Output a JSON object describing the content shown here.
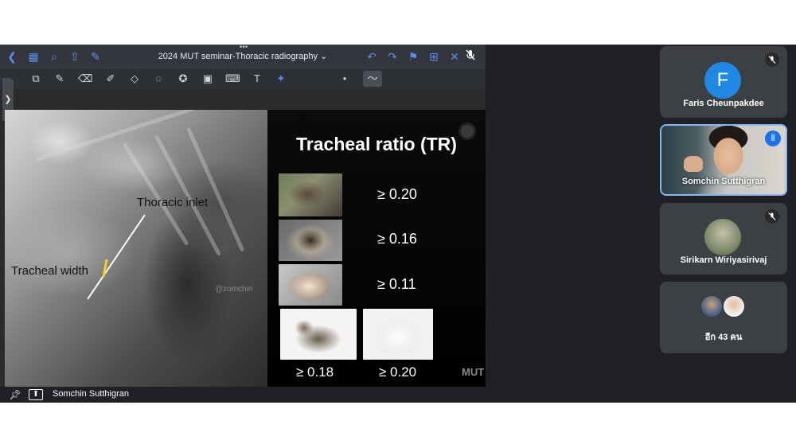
{
  "presentation": {
    "doc_title": "2024 MUT seminar-Thoracic radiography",
    "title_chevron": "⌄",
    "grip": "•••",
    "top_icons": {
      "back": "chevron-left-icon",
      "grid": "grid-icon",
      "search": "search-icon",
      "share": "share-icon",
      "mic_marker": "pen-mic-icon",
      "undo": "undo-icon",
      "redo": "redo-icon",
      "bookmark": "bookmark-icon",
      "add_page": "add-page-icon",
      "close": "close-icon",
      "muted": "mic-off-icon"
    },
    "tools": [
      "scan-icon",
      "pen-icon",
      "eraser-icon",
      "highlighter-icon",
      "shapes-icon",
      "lasso-icon",
      "star-icon",
      "image-icon",
      "keyboard-icon",
      "text-icon",
      "laser-icon",
      "dot-icon",
      "stroke-icon"
    ],
    "side_handle": "❯",
    "slide": {
      "title": "Tracheal ratio (TR)",
      "xray_label_inlet": "Thoracic inlet",
      "xray_label_width": "Tracheal width",
      "watermark": "@zomchin",
      "ratios": [
        "≥ 0.20",
        "≥  0.16",
        "≥ 0.11",
        "≥  0.18",
        "≥ 0.20"
      ],
      "logo": "MUT"
    },
    "presenter": {
      "name": "Somchin Sutthigran"
    }
  },
  "participants": [
    {
      "name": "Faris Cheunpakdee",
      "initial": "F",
      "muted": true
    },
    {
      "name": "Somchin Sutthigran",
      "speaking": true
    },
    {
      "name": "Sirikarn Wiriyasirivaj",
      "muted": true
    }
  ],
  "more": {
    "label": "อีก 43 คน"
  },
  "colors": {
    "accent": "#8ab4f8",
    "avatar_f": "#1e88e5",
    "tile_bg": "#3c4043",
    "stage_bg": "#202124",
    "marker_yellow": "#f2d21b"
  }
}
